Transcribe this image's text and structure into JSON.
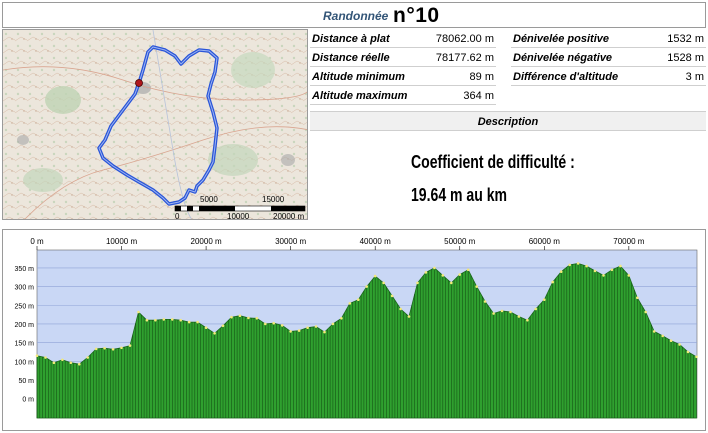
{
  "header": {
    "label": "Randonnée",
    "number": "n°10"
  },
  "stats": {
    "left": [
      {
        "label": "Distance à plat",
        "value": "78062.00 m"
      },
      {
        "label": "Distance réelle",
        "value": "78177.62 m"
      },
      {
        "label": "Altitude minimum",
        "value": "89 m"
      },
      {
        "label": "Altitude maximum",
        "value": "364 m"
      }
    ],
    "right": [
      {
        "label": "Dénivelée positive",
        "value": "1532 m"
      },
      {
        "label": "Dénivelée négative",
        "value": "1528 m"
      },
      {
        "label": "Différence d'altitude",
        "value": "3 m"
      }
    ]
  },
  "description": {
    "header": "Description"
  },
  "difficulty": {
    "line1": "Coefficient de difficulté :",
    "line2": "19.64 m au km"
  },
  "map": {
    "scale_labels": [
      "0",
      "5000",
      "10000",
      "15000",
      "20000 m"
    ],
    "route_color": "#2a55d8",
    "start_marker_color": "#b0161c"
  },
  "chart_data": {
    "type": "area",
    "title": "",
    "xlabel": "",
    "ylabel": "",
    "x_tick_labels": [
      "0 m",
      "10000 m",
      "20000 m",
      "30000 m",
      "40000 m",
      "50000 m",
      "60000 m",
      "70000 m"
    ],
    "x_ticks": [
      0,
      10000,
      20000,
      30000,
      40000,
      50000,
      60000,
      70000
    ],
    "y_tick_labels": [
      "0 m",
      "50 m",
      "100 m",
      "150 m",
      "200 m",
      "250 m",
      "300 m",
      "350 m"
    ],
    "y_ticks": [
      0,
      50,
      100,
      150,
      200,
      250,
      300,
      350
    ],
    "xlim": [
      0,
      78062
    ],
    "ylim": [
      -52,
      398
    ],
    "fill_color": "#2fa02f",
    "background_color": "#c9d7f5",
    "series": [
      {
        "x": [
          0,
          1000,
          2000,
          3000,
          4000,
          5000,
          6000,
          7000,
          8000,
          9000,
          10000,
          11000,
          12000,
          13000,
          14000,
          15000,
          16000,
          17000,
          18000,
          19000,
          20000,
          21000,
          22000,
          23000,
          24000,
          25000,
          26000,
          27000,
          28000,
          29000,
          30000,
          31000,
          32000,
          33000,
          34000,
          35000,
          36000,
          37000,
          38000,
          39000,
          40000,
          41000,
          42000,
          43000,
          44000,
          45000,
          46000,
          47000,
          48000,
          49000,
          50000,
          51000,
          52000,
          53000,
          54000,
          55000,
          56000,
          57000,
          58000,
          59000,
          60000,
          61000,
          62000,
          63000,
          64000,
          65000,
          66000,
          67000,
          68000,
          69000,
          70000,
          71000,
          72000,
          73000,
          74000,
          75000,
          76000,
          77000,
          78000
        ],
        "y": [
          115,
          110,
          96,
          104,
          96,
          92,
          110,
          133,
          135,
          132,
          136,
          142,
          232,
          210,
          210,
          212,
          212,
          210,
          205,
          205,
          190,
          175,
          195,
          218,
          222,
          216,
          215,
          200,
          202,
          196,
          180,
          182,
          190,
          193,
          178,
          200,
          215,
          255,
          265,
          300,
          328,
          310,
          275,
          240,
          220,
          310,
          338,
          350,
          330,
          310,
          332,
          345,
          300,
          260,
          228,
          235,
          232,
          220,
          210,
          240,
          265,
          312,
          340,
          358,
          362,
          355,
          342,
          330,
          345,
          355,
          330,
          270,
          232,
          180,
          168,
          155,
          145,
          125,
          112
        ]
      }
    ]
  }
}
